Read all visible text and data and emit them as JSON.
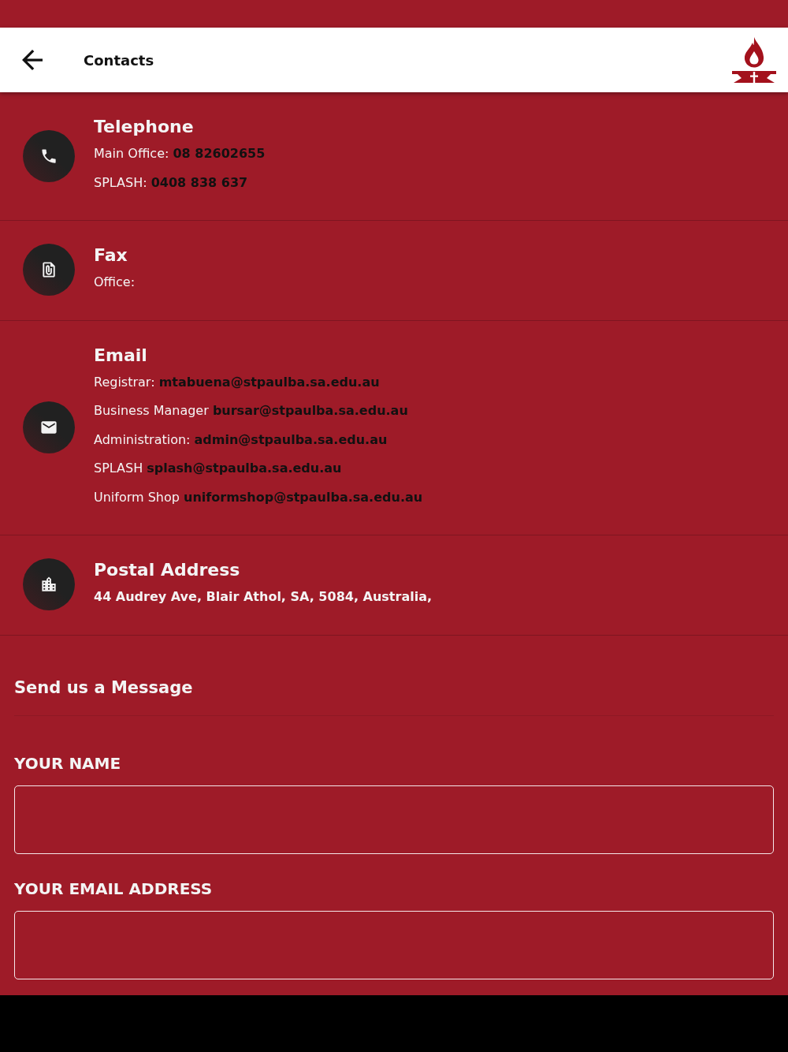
{
  "header": {
    "title": "Contacts"
  },
  "sections": [
    {
      "kind": "phone",
      "title": "Telephone",
      "lines": [
        {
          "label": "Main Office:",
          "value": "08 82602655"
        },
        {
          "label": "SPLASH:",
          "value": "0408 838 637"
        }
      ]
    },
    {
      "kind": "fax",
      "title": "Fax",
      "lines": [
        {
          "label": "Office:"
        }
      ]
    },
    {
      "kind": "email",
      "title": "Email",
      "lines": [
        {
          "label": "Registrar:",
          "value": "mtabuena@stpaulba.sa.edu.au"
        },
        {
          "label": "Business Manager",
          "value": "bursar@stpaulba.sa.edu.au"
        },
        {
          "label": "Administration:",
          "value": "admin@stpaulba.sa.edu.au"
        },
        {
          "label": "SPLASH",
          "value": "splash@stpaulba.sa.edu.au"
        },
        {
          "label": "Uniform Shop",
          "value": "uniformshop@stpaulba.sa.edu.au"
        }
      ]
    },
    {
      "kind": "building",
      "title": "Postal Address",
      "lines": [
        {
          "text": "44 Audrey Ave, Blair Athol, SA, 5084, Australia,"
        }
      ]
    }
  ],
  "message_form": {
    "title": "Send us a Message",
    "fields": [
      {
        "label": "YOUR NAME"
      },
      {
        "label": "YOUR EMAIL ADDRESS"
      }
    ]
  }
}
